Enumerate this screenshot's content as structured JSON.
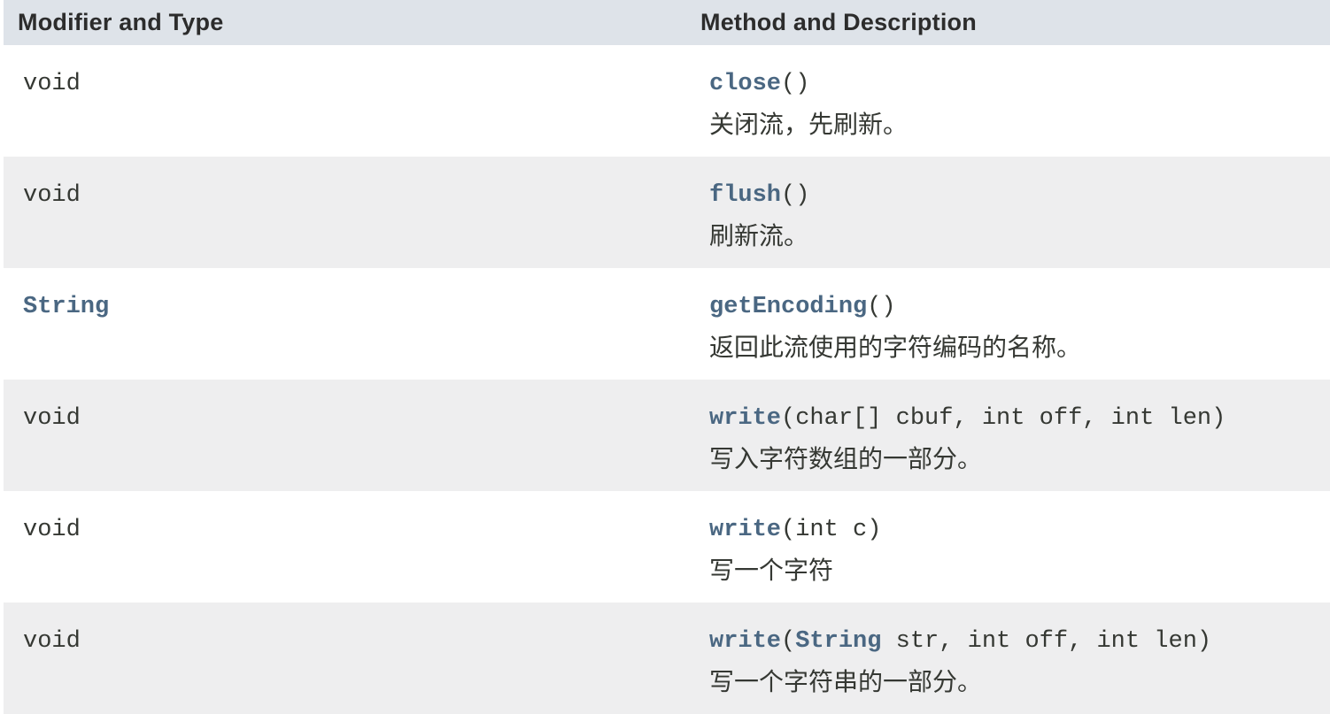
{
  "header": {
    "col_type": "Modifier and Type",
    "col_method": "Method and Description"
  },
  "rows": [
    {
      "type": "void",
      "method_name": "close",
      "params": "()",
      "description": "关闭流，先刷新。"
    },
    {
      "type": "void",
      "method_name": "flush",
      "params": "()",
      "description": "刷新流。"
    },
    {
      "type": "String",
      "method_name": "getEncoding",
      "params": "()",
      "description": "返回此流使用的字符编码的名称。"
    },
    {
      "type": "void",
      "method_name": "write",
      "params": "(char[] cbuf, int off, int len)",
      "description": "写入字符数组的一部分。"
    },
    {
      "type": "void",
      "method_name": "write",
      "params": "(int c)",
      "description": "写一个字符"
    },
    {
      "type": "void",
      "method_name": "write",
      "params_open": "(",
      "params_type_link": "String",
      "params_rest": " str, int off, int len)",
      "description": "写一个字符串的一部分。"
    }
  ],
  "colors": {
    "header_bg": "#dee3e9",
    "row_alt_bg": "#eeeeef",
    "link": "#4a6782",
    "text": "#353833"
  }
}
